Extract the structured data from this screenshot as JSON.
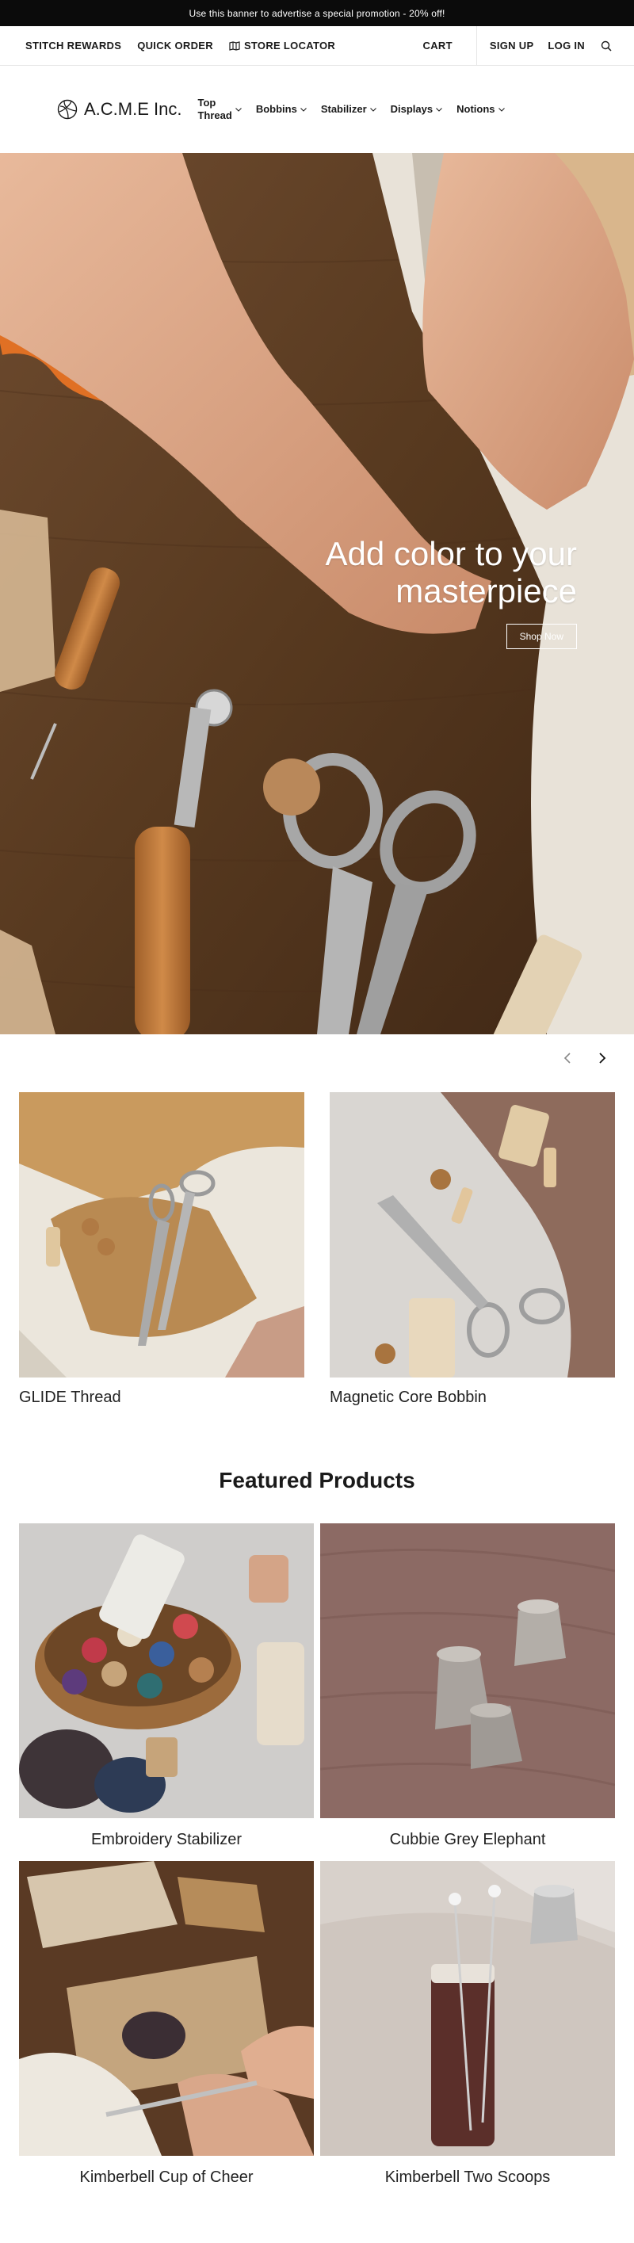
{
  "promo": {
    "text": "Use this banner to advertise a special promotion - 20% off!"
  },
  "utility": {
    "stitch_rewards": "STITCH REWARDS",
    "quick_order": "QUICK ORDER",
    "store_locator": "STORE LOCATOR",
    "cart": "CART",
    "sign_up": "SIGN UP",
    "log_in": "LOG IN"
  },
  "header": {
    "logo_text": "A.C.M.E Inc.",
    "nav": [
      {
        "label_line1": "Top",
        "label_line2": "Thread"
      },
      {
        "label": "Bobbins"
      },
      {
        "label": "Stabilizer"
      },
      {
        "label": "Displays"
      },
      {
        "label": "Notions"
      }
    ]
  },
  "hero": {
    "title": "Add color to your masterpiece",
    "button": "Shop Now"
  },
  "collections": [
    {
      "title": "GLIDE Thread"
    },
    {
      "title": "Magnetic Core Bobbin"
    }
  ],
  "featured": {
    "title": "Featured Products",
    "products": [
      {
        "name": "Embroidery Stabilizer"
      },
      {
        "name": "Cubbie Grey Elephant"
      },
      {
        "name": "Kimberbell Cup of Cheer"
      },
      {
        "name": "Kimberbell Two Scoops"
      }
    ]
  },
  "colors": {
    "banner_bg": "#0b0b0b",
    "text": "#1a1a1a",
    "hero_wood": "#5a3b24"
  }
}
